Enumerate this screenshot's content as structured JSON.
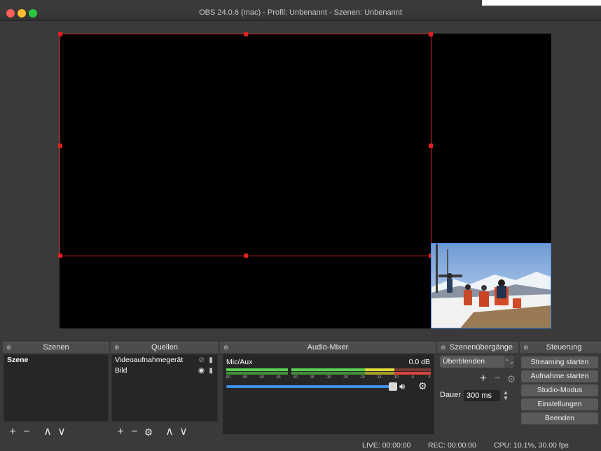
{
  "window": {
    "title": "OBS 24.0.6 (mac) - Profil: Unbenannt - Szenen: Unbenannt"
  },
  "colors": {
    "selection": "#e01f1f",
    "image_outline": "#3f8fe8",
    "meter_green": "#5bd14f",
    "meter_yellow": "#e1dc3a",
    "meter_red": "#d8443b",
    "slider": "#3f8fe8"
  },
  "scenes": {
    "header": "Szenen",
    "items": [
      "Szene"
    ]
  },
  "sources": {
    "header": "Quellen",
    "items": [
      {
        "label": "Videoaufnahmegerät",
        "visible_icon": "eye-slash-icon",
        "lock_icon": "lock-icon"
      },
      {
        "label": "Bild",
        "visible_icon": "eye-icon",
        "lock_icon": "lock-icon"
      }
    ]
  },
  "mixer": {
    "header": "Audio-Mixer",
    "channel": "Mic/Aux",
    "level": "0.0 dB",
    "volume_fraction": 1.0,
    "ticks": [
      "-60",
      "-55",
      "-50",
      "-45",
      "-40",
      "-35",
      "-30",
      "-25",
      "-20",
      "-15",
      "-10",
      "-5",
      "0"
    ]
  },
  "transitions": {
    "header": "Szenenübergänge",
    "selected": "Überblenden",
    "duration_label": "Dauer",
    "duration_value": "300 ms"
  },
  "controls": {
    "header": "Steuerung",
    "buttons": [
      "Streaming starten",
      "Aufnahme starten",
      "Studio-Modus",
      "Einstellungen",
      "Beenden"
    ]
  },
  "status": {
    "live": "LIVE: 00:00:00",
    "rec": "REC: 00:00:00",
    "cpu": "CPU: 10.1%, 30.00 fps"
  }
}
